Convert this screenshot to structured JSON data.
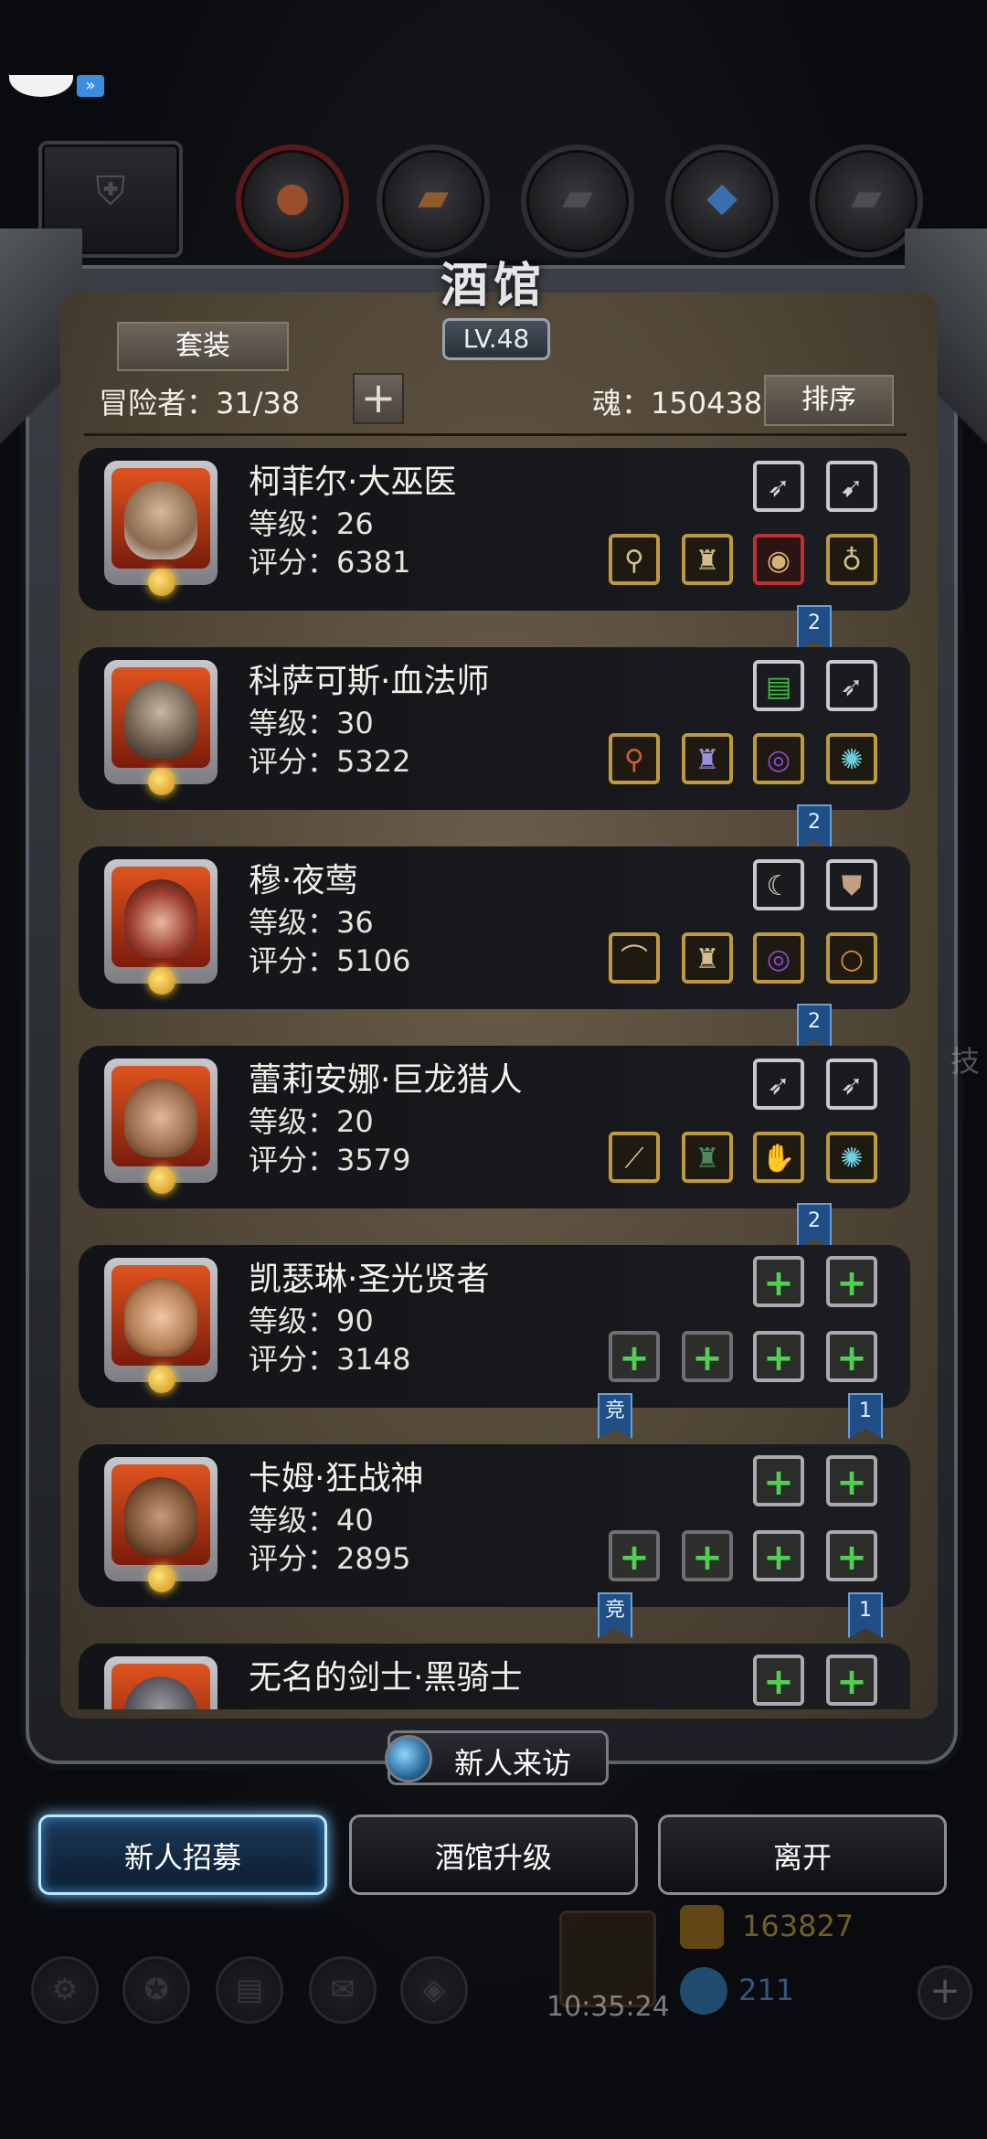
{
  "title": "酒馆",
  "level": "LV.48",
  "header": {
    "set_button": "套装",
    "adventurers_label": "冒险者：31/38",
    "soul_label": "魂：150438",
    "sort_button": "排序"
  },
  "heroes": [
    {
      "name": "柯菲尔·大巫医",
      "level": "等级：26",
      "score": "评分：6381",
      "badge_right": "2",
      "badge_left": ""
    },
    {
      "name": "科萨可斯·血法师",
      "level": "等级：30",
      "score": "评分：5322",
      "badge_right": "2",
      "badge_left": ""
    },
    {
      "name": "穆·夜莺",
      "level": "等级：36",
      "score": "评分：5106",
      "badge_right": "2",
      "badge_left": ""
    },
    {
      "name": "蕾莉安娜·巨龙猎人",
      "level": "等级：20",
      "score": "评分：3579",
      "badge_right": "2",
      "badge_left": ""
    },
    {
      "name": "凯瑟琳·圣光贤者",
      "level": "等级：90",
      "score": "评分：3148",
      "badge_right": "1",
      "badge_left": "竞"
    },
    {
      "name": "卡姆·狂战神",
      "level": "等级：40",
      "score": "评分：2895",
      "badge_right": "1",
      "badge_left": "竞"
    },
    {
      "name": "无名的剑士·黑骑士",
      "level": "",
      "score": "",
      "badge_right": "",
      "badge_left": ""
    }
  ],
  "bottom": {
    "visit_button": "新人来访",
    "recruit_button": "新人招募",
    "upgrade_button": "酒馆升级",
    "leave_button": "离开",
    "timer": "10:35:24",
    "gold": "163827",
    "gems": "211",
    "side_text": "技"
  },
  "icons": {
    "weapon": "blade-icon",
    "staff": "staff-icon",
    "armor": "armor-icon",
    "ring": "ring-icon",
    "amulet": "amulet-icon",
    "add": "plus-icon"
  }
}
